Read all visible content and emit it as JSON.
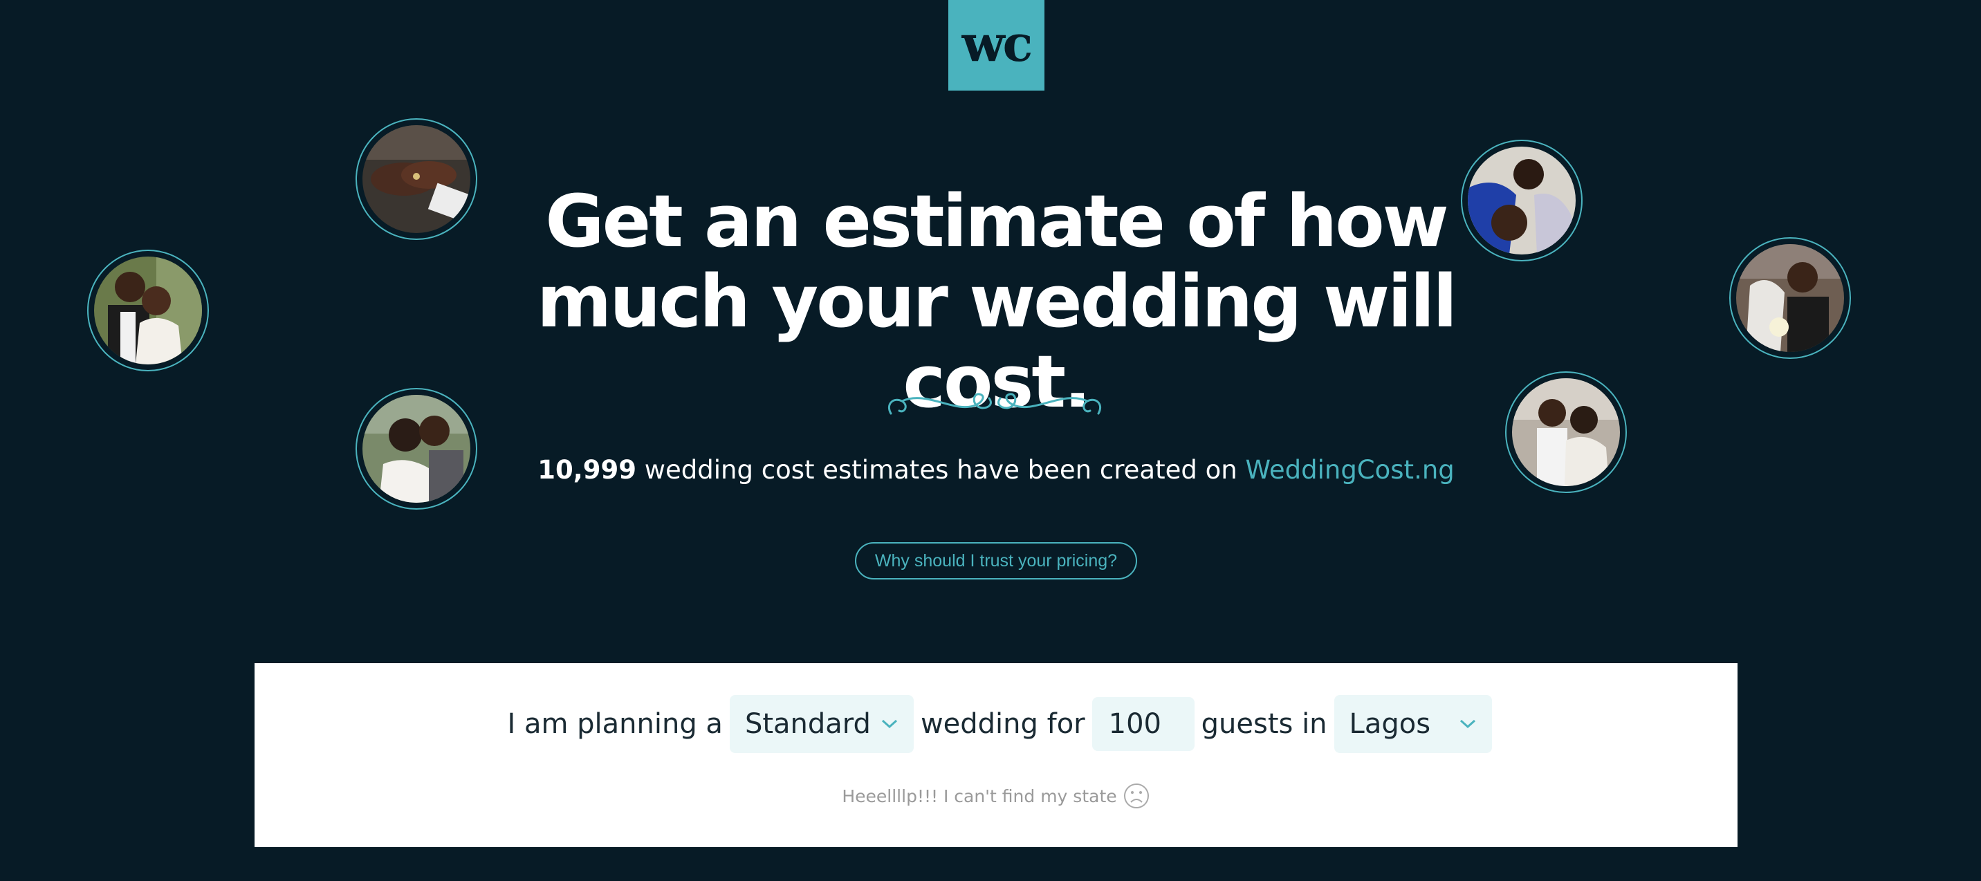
{
  "logo": {
    "text": "wc"
  },
  "hero": {
    "headline": "Get an estimate of how much your wedding will cost.",
    "stats_count": "10,999",
    "stats_text": " wedding cost estimates have been created on ",
    "stats_site": "WeddingCost.ng",
    "trust_button": "Why should I trust your pricing?"
  },
  "form": {
    "prefix": "I am planning a",
    "wedding_type": "Standard",
    "middle": "wedding for",
    "guests": "100",
    "suffix": "guests in",
    "location": "Lagos",
    "help_text": "Heeellllp!!! I can't find my state",
    "help_icon": "sad-face-icon"
  },
  "colors": {
    "background": "#071b26",
    "accent": "#4ab3be",
    "panel": "#ffffff",
    "field_bg": "#ebf7f8"
  }
}
